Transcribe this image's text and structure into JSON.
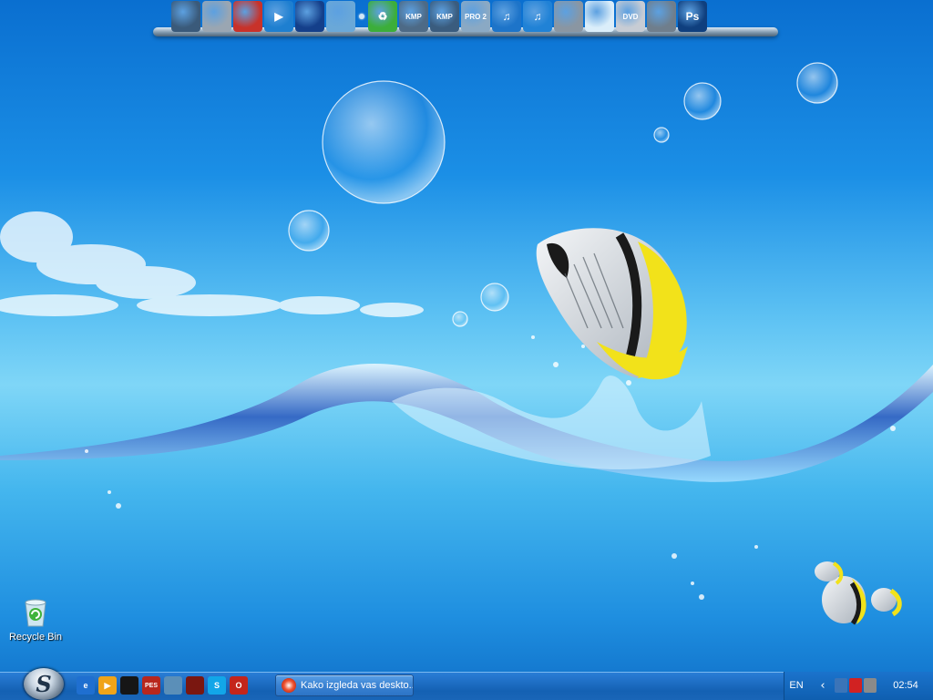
{
  "dock": {
    "icons": [
      {
        "name": "monitor-icon",
        "glyph": "",
        "color": "#3a5a7a"
      },
      {
        "name": "notebook-icon",
        "glyph": "",
        "color": "#9aa6b2"
      },
      {
        "name": "fire-app-icon",
        "glyph": "",
        "color": "#c8322a"
      },
      {
        "name": "media-play-icon",
        "glyph": "▶",
        "color": "#1e7fd0"
      },
      {
        "name": "globe-icon",
        "glyph": "",
        "color": "#143f8a"
      },
      {
        "name": "cursor-arrow-icon",
        "glyph": "",
        "color": "#6aa8d8"
      },
      {
        "name": "recycle-icon",
        "glyph": "♻",
        "color": "#3cae3a"
      },
      {
        "name": "kmp-player-icon",
        "glyph": "KMP",
        "color": "#4d6a86"
      },
      {
        "name": "kmp-player-icon-2",
        "glyph": "KMP",
        "color": "#3a5c7e"
      },
      {
        "name": "search-pro-icon",
        "glyph": "PRO 2",
        "color": "#8aa9c4"
      },
      {
        "name": "music-note-icon",
        "glyph": "♫",
        "color": "#1d74c9"
      },
      {
        "name": "music-note-icon-2",
        "glyph": "♫",
        "color": "#2082d6"
      },
      {
        "name": "microphone-icon",
        "glyph": "",
        "color": "#8a96a2"
      },
      {
        "name": "water-wave-icon",
        "glyph": "",
        "color": "#dbeefa"
      },
      {
        "name": "dvd-disc-icon",
        "glyph": "DVD",
        "color": "#c7ccd4"
      },
      {
        "name": "hammer-tool-icon",
        "glyph": "",
        "color": "#6f7e8c"
      },
      {
        "name": "photoshop-icon",
        "glyph": "Ps",
        "color": "#0f3f7e"
      }
    ]
  },
  "desktop": {
    "recycle_bin_label": "Recycle Bin"
  },
  "taskbar": {
    "quick_launch": [
      {
        "name": "ie-browser-icon",
        "color": "#1f6fd0",
        "glyph": "e"
      },
      {
        "name": "media-player-icon",
        "color": "#f0a418",
        "glyph": "▶"
      },
      {
        "name": "pacman-app-icon",
        "color": "#161616",
        "glyph": ""
      },
      {
        "name": "pes-game-icon",
        "color": "#b8271d",
        "glyph": "PES"
      },
      {
        "name": "cloud-drive-icon",
        "color": "#5b8fb8",
        "glyph": ""
      },
      {
        "name": "red-app-icon",
        "color": "#7a1710",
        "glyph": ""
      },
      {
        "name": "skype-icon",
        "color": "#12a6e8",
        "glyph": "S"
      },
      {
        "name": "opera-browser-icon",
        "color": "#c4251b",
        "glyph": "O"
      }
    ],
    "task_button_label": "Kako izgleda vas deskto...",
    "language": "EN",
    "tray_icons": [
      {
        "name": "network-tray-icon",
        "color": "#3b74b8"
      },
      {
        "name": "kaspersky-tray-icon",
        "color": "#d12222"
      },
      {
        "name": "sound-tray-icon",
        "color": "#8a8a8a"
      }
    ],
    "clock": "02:54"
  }
}
